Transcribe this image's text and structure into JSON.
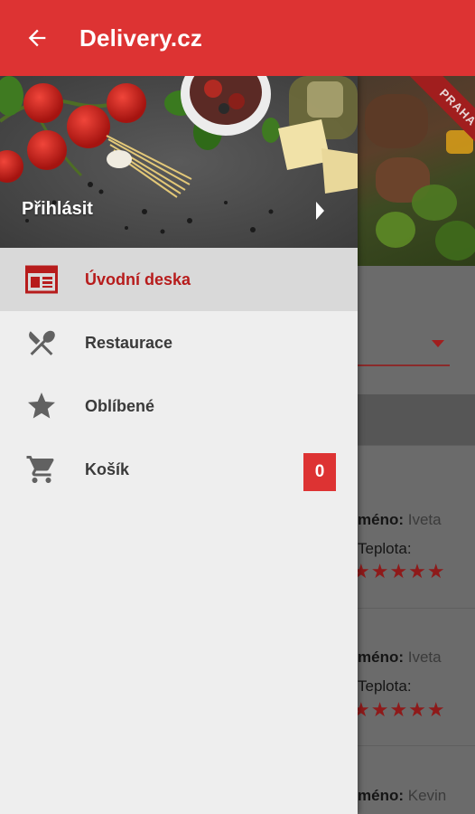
{
  "app_bar": {
    "title": "Delivery.cz",
    "back_icon": "arrow-back-icon",
    "background": "#dd3333"
  },
  "drawer": {
    "header": {
      "login_label": "Přihlásit",
      "chevron_icon": "chevron-right-icon"
    },
    "items": [
      {
        "label": "Úvodní deska",
        "icon": "dashboard-icon",
        "active": true
      },
      {
        "label": "Restaurace",
        "icon": "fork-knife-icon",
        "active": false
      },
      {
        "label": "Oblíbené",
        "icon": "star-icon",
        "active": false
      },
      {
        "label": "Košík",
        "icon": "cart-icon",
        "active": false,
        "badge": "0"
      }
    ],
    "accent": "#b71c1c"
  },
  "background_screen": {
    "ribbon": "PRAHA",
    "reviews": [
      {
        "name_label": "méno:",
        "name_value": "Iveta",
        "rating_label": "Teplota:",
        "stars": "★★★★★"
      },
      {
        "name_label": "méno:",
        "name_value": "Iveta",
        "rating_label": "Teplota:",
        "stars": "★★★★★"
      },
      {
        "name_label": "méno:",
        "name_value": "Kevin"
      }
    ]
  }
}
